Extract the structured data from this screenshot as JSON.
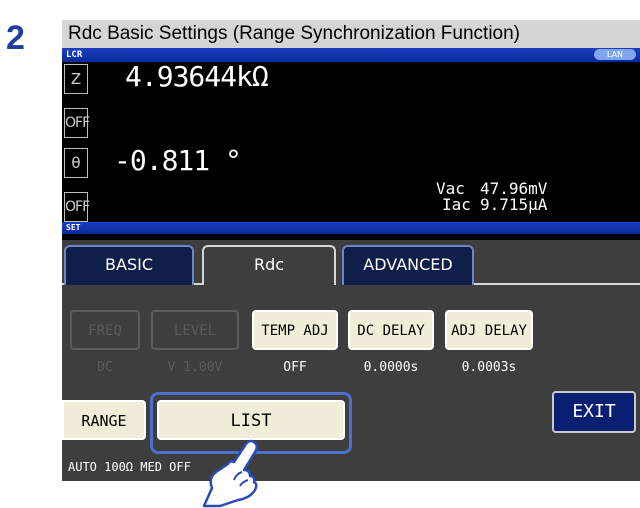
{
  "step": {
    "number": "2",
    "title": "Rdc Basic Settings (Range Synchronization Function)"
  },
  "status": {
    "lcr_label": "LCR",
    "lan_badge": "LAN",
    "set_label": "SET"
  },
  "measurement": {
    "param1_label": "Z",
    "param1_value": "4.93644kΩ",
    "param2_label": "OFF",
    "param3_label": "θ",
    "param3_value": "-0.811 °",
    "param4_label": "OFF",
    "vac_label": "Vac",
    "vac_value": "47.96mV",
    "iac_label": "Iac",
    "iac_value": "9.715μA"
  },
  "tabs": [
    {
      "label": "BASIC",
      "active": false
    },
    {
      "label": "Rdc",
      "active": true
    },
    {
      "label": "ADVANCED",
      "active": false
    }
  ],
  "settings": {
    "freq": {
      "label": "FREQ",
      "value": "DC",
      "enabled": false
    },
    "level": {
      "label": "LEVEL",
      "value": "V 1.00V",
      "enabled": false
    },
    "temp_adj": {
      "label": "TEMP ADJ",
      "value": "OFF",
      "enabled": true
    },
    "dc_delay": {
      "label": "DC DELAY",
      "value": "0.0000s",
      "enabled": true
    },
    "adj_delay": {
      "label": "ADJ DELAY",
      "value": "0.0003s",
      "enabled": true
    }
  },
  "range": {
    "label": "RANGE",
    "info": "AUTO  100Ω MED OFF"
  },
  "list_label": "LIST",
  "exit_label": "EXIT",
  "colors": {
    "status_bar": "#0a2a9b",
    "exit_button": "#0a1f72",
    "highlight": "#4d6fd0"
  }
}
